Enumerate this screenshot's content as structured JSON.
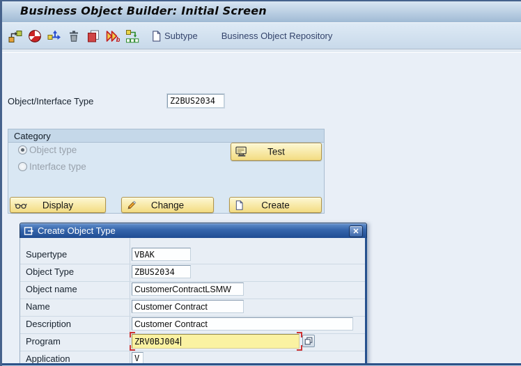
{
  "window": {
    "title": "Business Object Builder: Initial Screen"
  },
  "toolbar": {
    "icons": [
      "relationships-icon",
      "check-circle-icon",
      "move-icon",
      "delete-icon",
      "copy-icon",
      "debug-icon",
      "generate-icon"
    ],
    "subtype_label": "Subtype",
    "repository_label": "Business Object Repository"
  },
  "form": {
    "object_interface_label": "Object/Interface Type",
    "object_interface_value": "Z2BUS2034"
  },
  "category": {
    "title": "Category",
    "radios": [
      {
        "label": "Object type",
        "selected": true
      },
      {
        "label": "Interface type",
        "selected": false
      }
    ],
    "test_button": "Test",
    "display_button": "Display",
    "change_button": "Change",
    "create_button": "Create"
  },
  "dialog": {
    "title": "Create Object Type",
    "close_glyph": "✕",
    "fields": [
      {
        "label": "Supertype",
        "value": "VBAK"
      },
      {
        "label": "Object Type",
        "value": "ZBUS2034"
      },
      {
        "label": "Object name",
        "value": "CustomerContractLSMW"
      },
      {
        "label": "Name",
        "value": "Customer Contract"
      },
      {
        "label": "Description",
        "value": "Customer Contract"
      },
      {
        "label": "Program",
        "value": "ZRV0BJ004",
        "focused": true
      },
      {
        "label": "Application",
        "value": "V"
      }
    ]
  },
  "colors": {
    "background": "#e9eff7",
    "button_yellow": "#f3dc82",
    "dialog_titlebar_blue": "#2a5aa0",
    "focus_field_yellow": "#faf2a2",
    "focus_corner_red": "#cf3333",
    "toolbar_text_blue": "#33436b"
  }
}
